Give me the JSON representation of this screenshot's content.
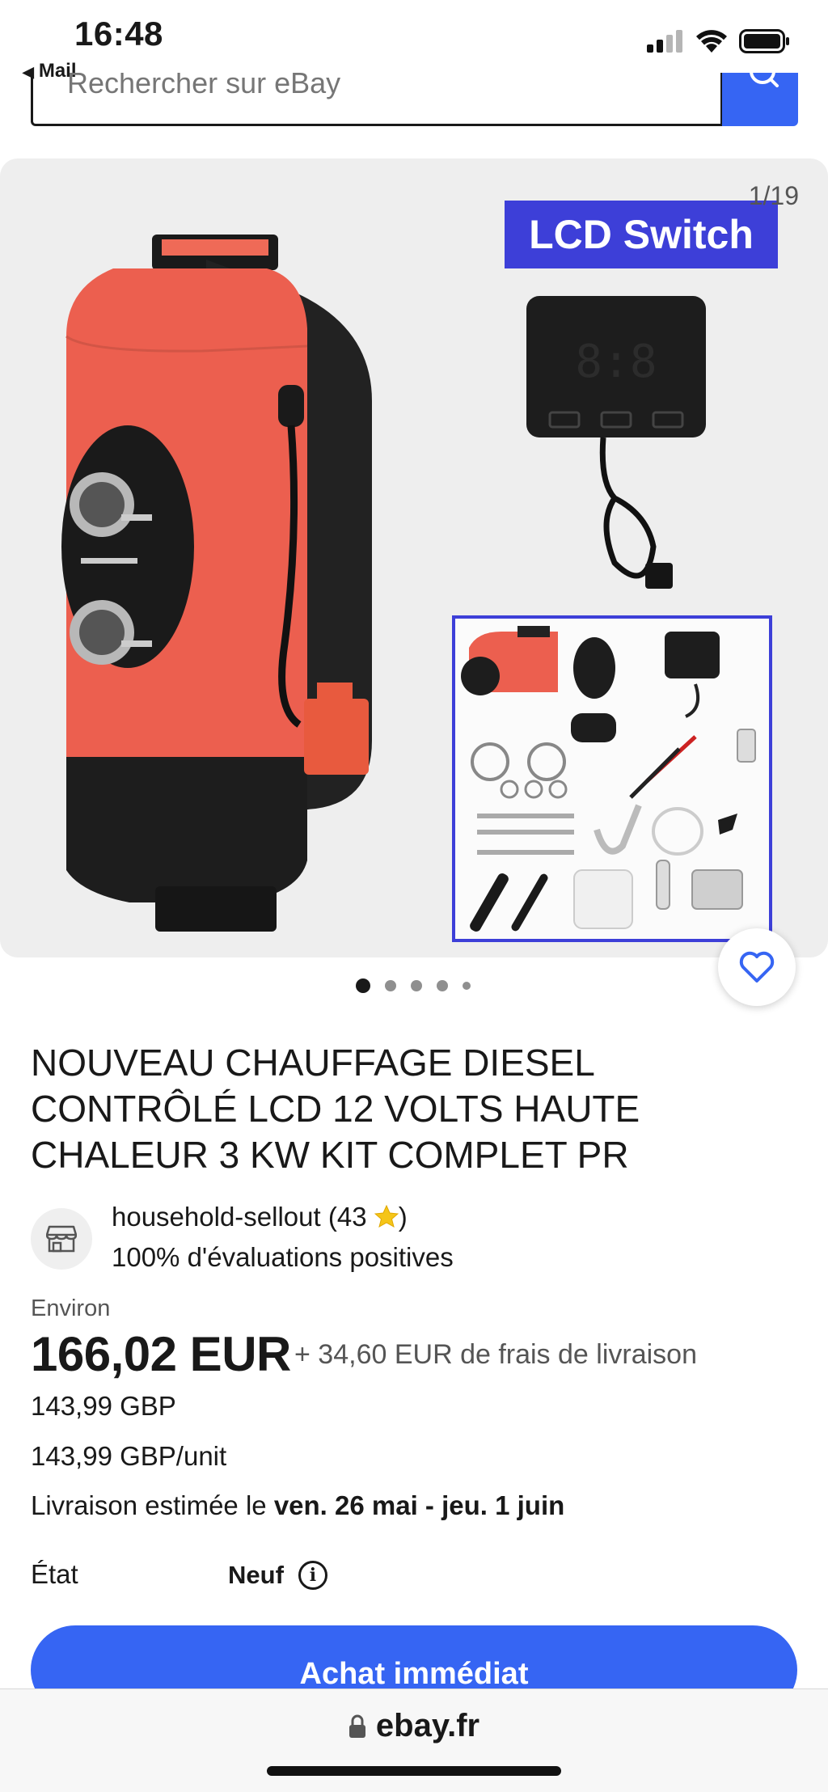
{
  "status_bar": {
    "time": "16:48",
    "back_label": "Mail"
  },
  "search": {
    "placeholder": "Rechercher sur eBay"
  },
  "gallery": {
    "counter": "1/19",
    "banner": "LCD Switch",
    "page_dots": 5,
    "active_dot": 0
  },
  "product": {
    "title": "NOUVEAU CHAUFFAGE DIESEL CONTRÔLÉ LCD 12 VOLTS HAUTE CHALEUR 3 KW KIT COMPLET PR",
    "seller": {
      "name": "household-sellout (43",
      "name_suffix": ")",
      "feedback": "100% d'évaluations positives"
    },
    "price": {
      "approx_label": "Environ",
      "amount": "166,02 EUR",
      "shipping": "+ 34,60 EUR de frais de livraison",
      "gbp": "143,99 GBP",
      "unit": "143,99 GBP/unit"
    },
    "delivery": {
      "prefix": "Livraison estimée le ",
      "dates": "ven. 26 mai - jeu. 1 juin"
    },
    "condition": {
      "label": "État",
      "value": "Neuf"
    },
    "buy_label": "Achat immédiat"
  },
  "browser": {
    "url": "ebay.fr"
  },
  "colors": {
    "accent": "#3665f3",
    "banner": "#3d3fd8",
    "heater_body": "#ec5f4f"
  }
}
